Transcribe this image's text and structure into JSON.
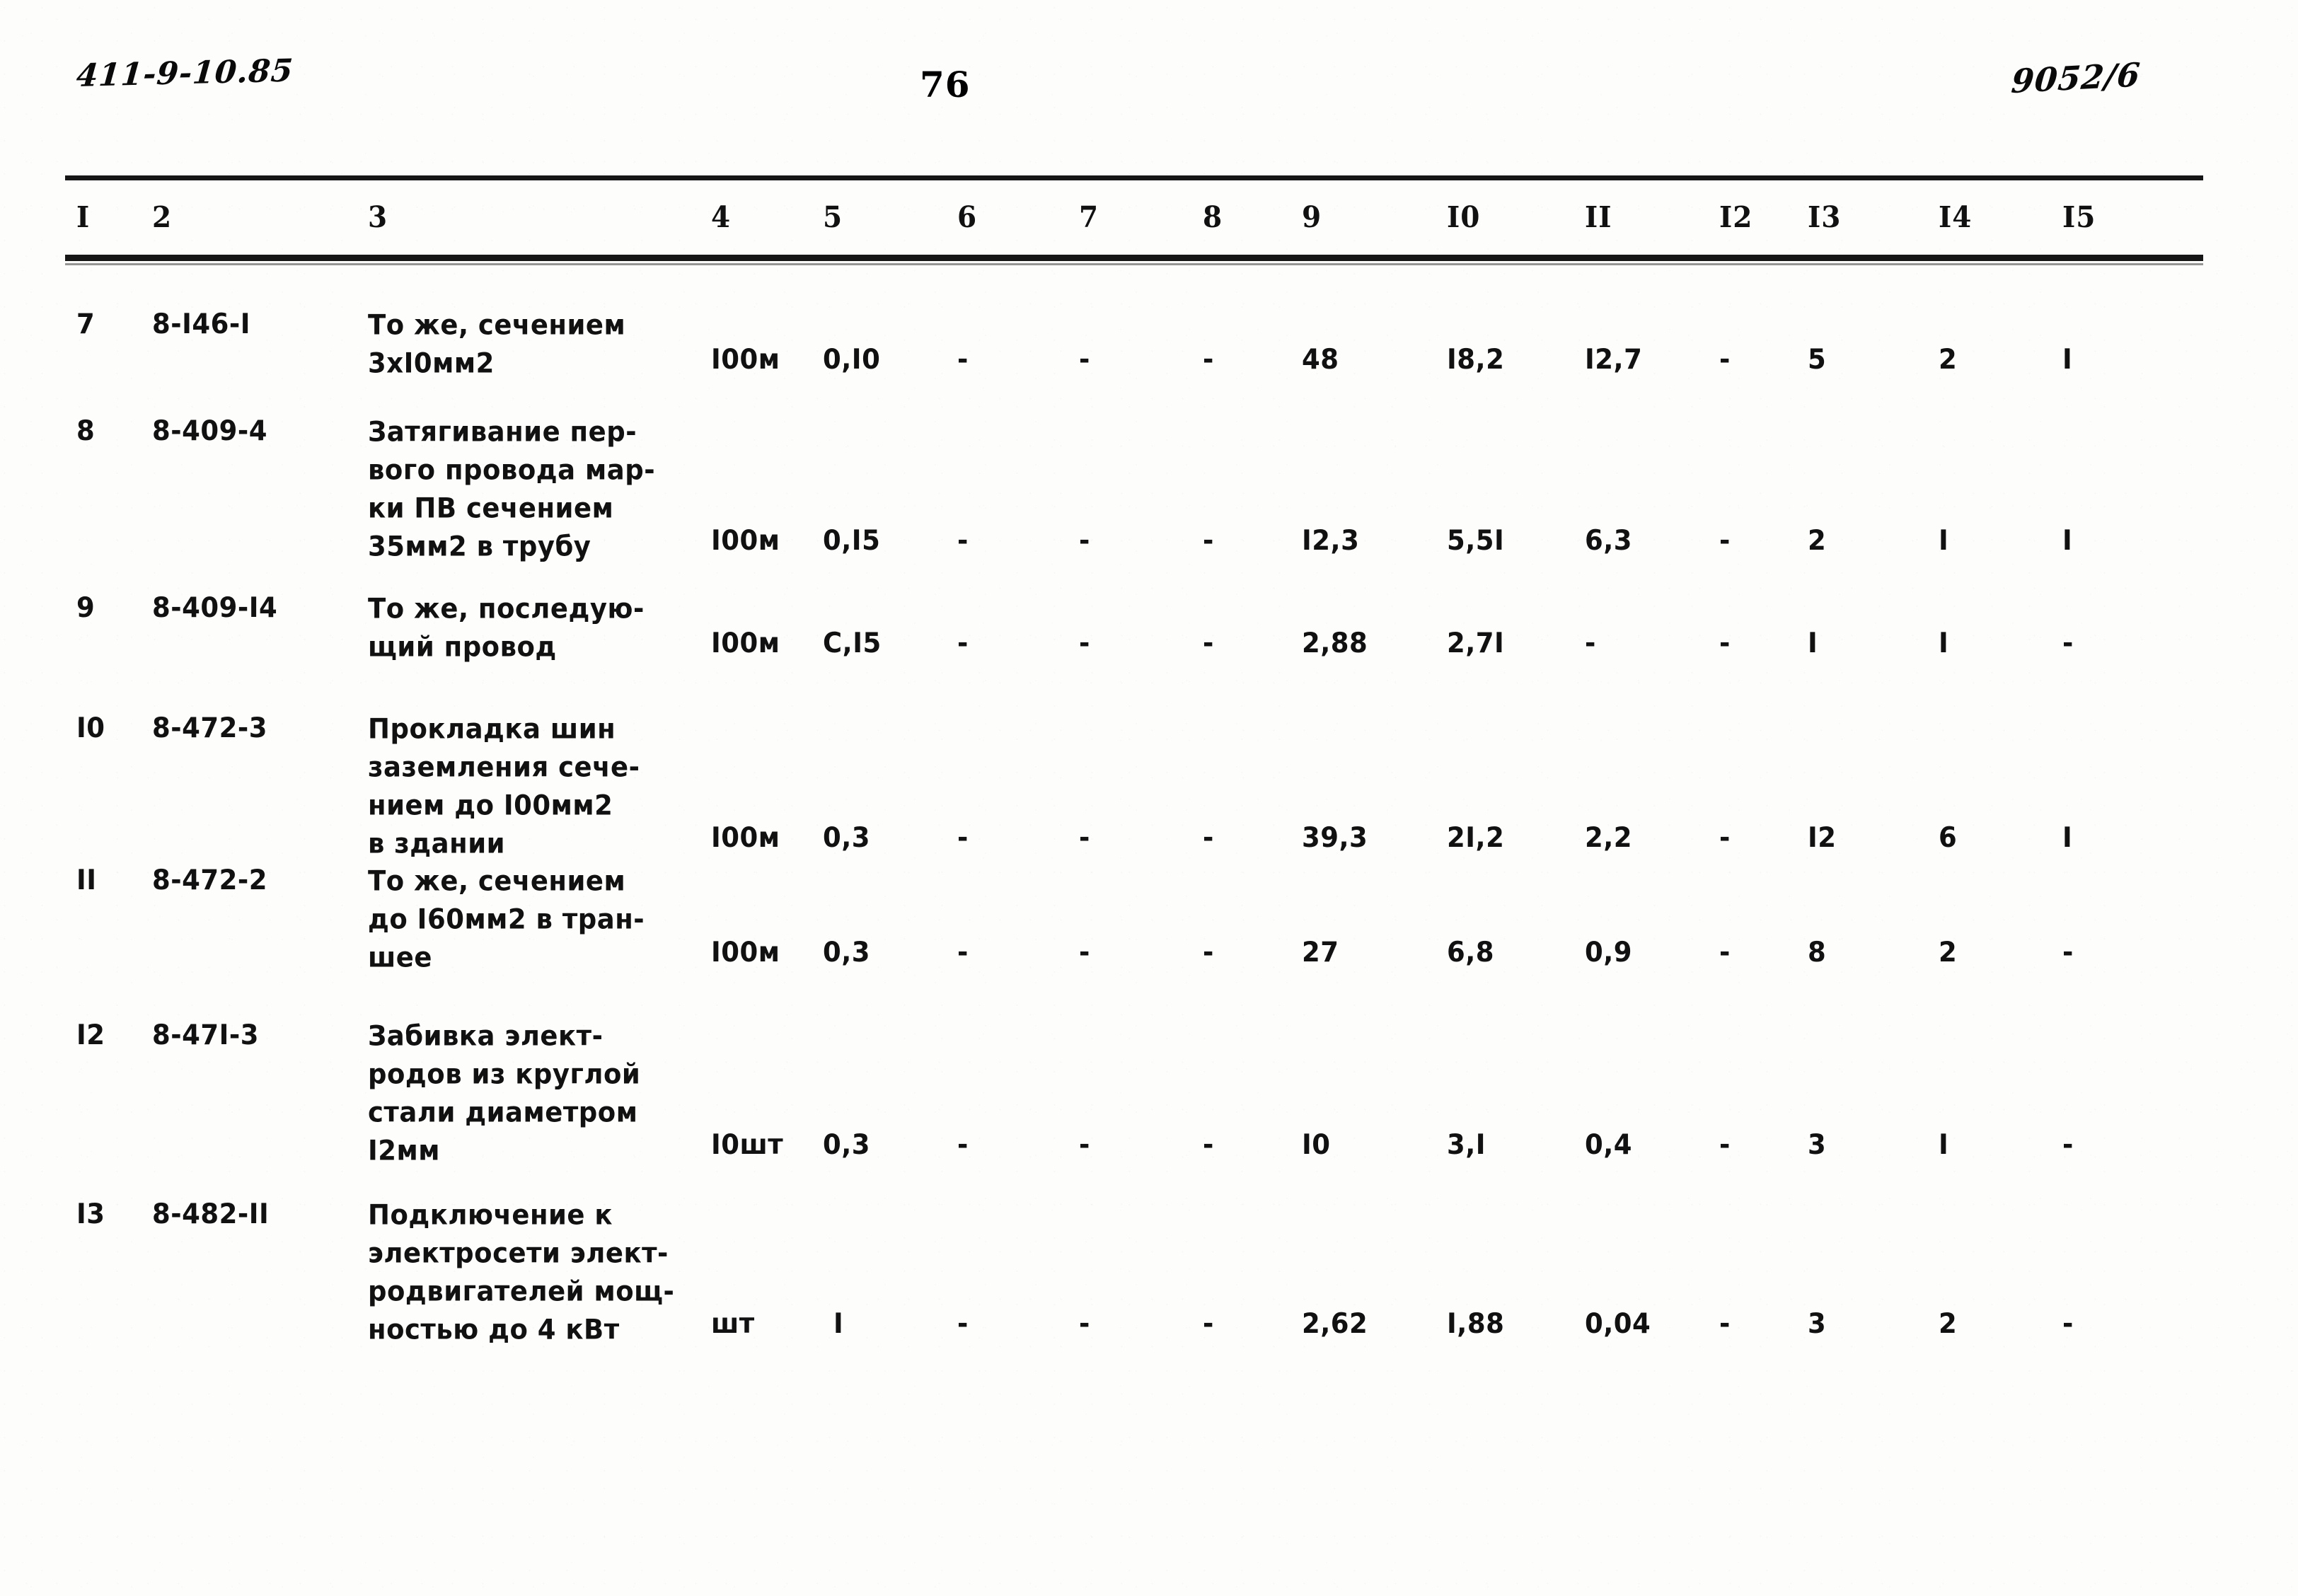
{
  "header": {
    "hand_left": "411-9-10.85",
    "page_number": "76",
    "hand_right": "9052/6"
  },
  "table": {
    "column_headers": [
      "I",
      "2",
      "3",
      "4",
      "5",
      "6",
      "7",
      "8",
      "9",
      "I0",
      "II",
      "I2",
      "I3",
      "I4",
      "I5"
    ],
    "rows": [
      {
        "c1": "7",
        "c2": "8-I46-I",
        "c3": "То же, сечением\n3хI0мм2",
        "c4": "I00м",
        "c5": "0,I0",
        "c6": "-",
        "c7": "-",
        "c8": "-",
        "c9": "48",
        "c10": "I8,2",
        "c11": "I2,7",
        "c12": "-",
        "c13": "5",
        "c14": "2",
        "c15": "I"
      },
      {
        "c1": "8",
        "c2": "8-409-4",
        "c3": "Затягивание пер-\nвого провода мар-\nки ПВ сечением\n35мм2 в трубу",
        "c4": "I00м",
        "c5": "0,I5",
        "c6": "-",
        "c7": "-",
        "c8": "-",
        "c9": "I2,3",
        "c10": "5,5I",
        "c11": "6,3",
        "c12": "-",
        "c13": "2",
        "c14": "I",
        "c15": "I"
      },
      {
        "c1": "9",
        "c2": "8-409-I4",
        "c3": "То же, последую-\nщий провод",
        "c4": "I00м",
        "c5": "С,I5",
        "c6": "-",
        "c7": "-",
        "c8": "-",
        "c9": "2,88",
        "c10": "2,7I",
        "c11": "-",
        "c12": "-",
        "c13": "I",
        "c14": "I",
        "c15": "-"
      },
      {
        "c1": "I0",
        "c2": "8-472-3",
        "c3": "Прокладка шин\nзаземления сече-\nнием до I00мм2\nв здании",
        "c4": "I00м",
        "c5": "0,3",
        "c6": "-",
        "c7": "-",
        "c8": "-",
        "c9": "39,3",
        "c10": "2I,2",
        "c11": "2,2",
        "c12": "-",
        "c13": "I2",
        "c14": "6",
        "c15": "I"
      },
      {
        "c1": "II",
        "c2": "8-472-2",
        "c3": "То же, сечением\nдо I60мм2 в тран-\nшее",
        "c4": "I00м",
        "c5": "0,3",
        "c6": "-",
        "c7": "-",
        "c8": "-",
        "c9": "27",
        "c10": "6,8",
        "c11": "0,9",
        "c12": "-",
        "c13": "8",
        "c14": "2",
        "c15": "-"
      },
      {
        "c1": "I2",
        "c2": "8-47I-3",
        "c3": "Забивка элект-\nродов из круглой\nстали диаметром\nI2мм",
        "c4": "I0шт",
        "c5": "0,3",
        "c6": "-",
        "c7": "-",
        "c8": "-",
        "c9": "I0",
        "c10": "3,I",
        "c11": "0,4",
        "c12": "-",
        "c13": "3",
        "c14": "I",
        "c15": "-"
      },
      {
        "c1": "I3",
        "c2": "8-482-II",
        "c3": "Подключение к\nэлектросети элект-\nродвигателей мощ-\nностью до 4 кВт",
        "c4": "шт",
        "c5": "I",
        "c6": "-",
        "c7": "-",
        "c8": "-",
        "c9": "2,62",
        "c10": "I,88",
        "c11": "0,04",
        "c12": "-",
        "c13": "3",
        "c14": "2",
        "c15": "-"
      }
    ]
  }
}
